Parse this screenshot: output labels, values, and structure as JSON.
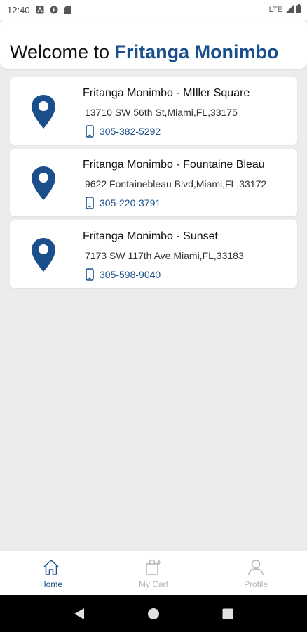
{
  "status_bar": {
    "time": "12:40",
    "network": "LTE",
    "icons": [
      "notification-a-icon",
      "notification-f-icon",
      "sd-card-icon",
      "signal-icon",
      "battery-icon"
    ]
  },
  "header": {
    "welcome_prefix": "Welcome to ",
    "brand": "Fritanga Monimbo"
  },
  "locations": [
    {
      "name": "Fritanga Monimbo - MIller Square",
      "address": "13710 SW 56th St,Miami,FL,33175",
      "phone": "305-382-5292"
    },
    {
      "name": "Fritanga Monimbo - Fountaine Bleau",
      "address": "9622 Fontainebleau Blvd,Miami,FL,33172",
      "phone": "305-220-3791"
    },
    {
      "name": "Fritanga Monimbo - Sunset",
      "address": "7173 SW 117th Ave,Miami,FL,33183",
      "phone": "305-598-9040"
    }
  ],
  "bottom_nav": {
    "home": "Home",
    "cart": "My Cart",
    "profile": "Profile"
  },
  "colors": {
    "brand": "#1a4f8c",
    "inactive": "#b5b5b5",
    "background": "#ececec"
  }
}
